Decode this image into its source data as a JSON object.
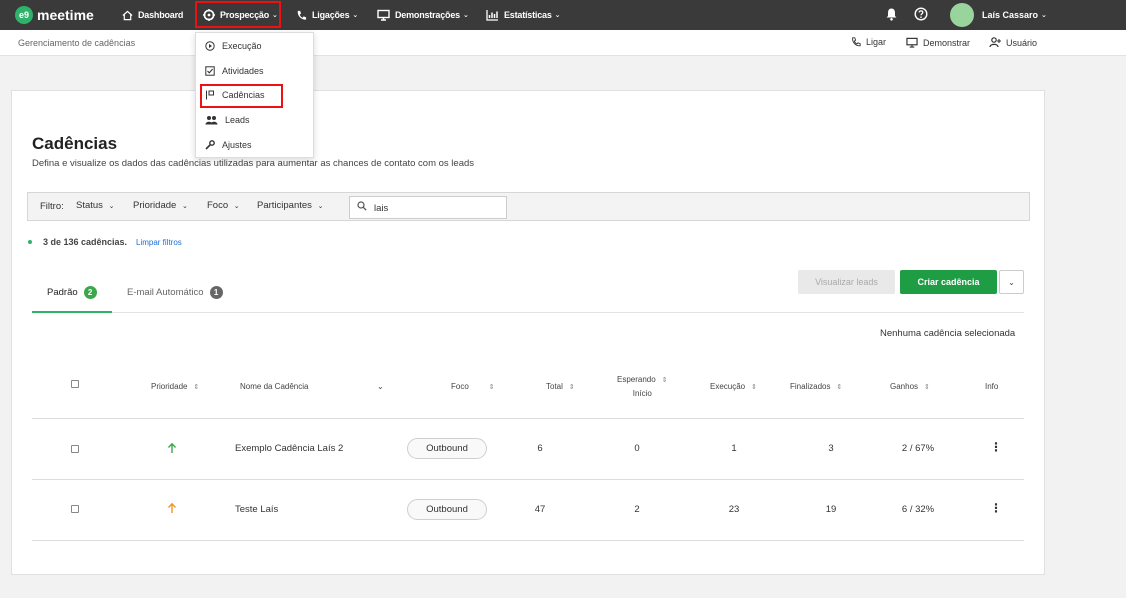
{
  "app": {
    "logo_badge": "e9",
    "logo_text": "meetime"
  },
  "nav": {
    "dashboard": "Dashboard",
    "prospeccao": "Prospecção",
    "ligacoes": "Ligações",
    "demonstracoes": "Demonstrações",
    "estatisticas": "Estatísticas",
    "user_name": "Laís Cassaro",
    "chevron": "⌄"
  },
  "subbar": {
    "breadcrumb": "Gerenciamento de cadências",
    "ligar": "Ligar",
    "demonstrar": "Demonstrar",
    "usuario": "Usuário"
  },
  "dropdown": {
    "items": [
      "Execução",
      "Atividades",
      "Cadências",
      "Leads",
      "Ajustes"
    ]
  },
  "page": {
    "title": "Cadências",
    "subtitle": "Defina e visualize os dados das cadências utilizadas para aumentar as chances de contato com os leads"
  },
  "filters": {
    "label": "Filtro:",
    "status": "Status",
    "prioridade": "Prioridade",
    "foco": "Foco",
    "participantes": "Participantes",
    "search_value": "lais"
  },
  "results": {
    "count": "3 de 136 cadências.",
    "clear": "Limpar filtros"
  },
  "tabs": [
    {
      "label": "Padrão",
      "badge": "2",
      "active": true
    },
    {
      "label": "E-mail Automático",
      "badge": "1",
      "active": false
    }
  ],
  "actions": {
    "view_leads": "Visualizar leads",
    "create": "Criar cadência",
    "more": "⌄"
  },
  "selection": "Nenhuma cadência selecionada",
  "table": {
    "headers": {
      "prioridade": "Prioridade",
      "nome": "Nome da Cadência",
      "foco": "Foco",
      "total": "Total",
      "esperando_1": "Esperando",
      "esperando_2": "Início",
      "execucao": "Execução",
      "finalizados": "Finalizados",
      "ganhos": "Ganhos",
      "info": "Info"
    },
    "rows": [
      {
        "priority_color": "#3aa84a",
        "name": "Exemplo Cadência Laís 2",
        "foco": "Outbound",
        "total": "6",
        "esperando": "0",
        "execucao": "1",
        "finalizados": "3",
        "ganhos": "2 / 67%"
      },
      {
        "priority_color": "#f0962a",
        "name": "Teste Laís",
        "foco": "Outbound",
        "total": "47",
        "esperando": "2",
        "execucao": "23",
        "finalizados": "19",
        "ganhos": "6 / 32%"
      }
    ]
  },
  "colors": {
    "brand": "#2fb36b",
    "nav_bg": "#3a3a3a",
    "highlight": "#e11111",
    "primary_button": "#1f9d45"
  }
}
